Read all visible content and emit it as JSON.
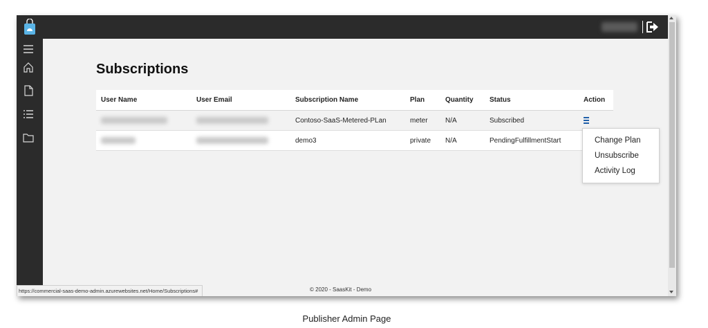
{
  "page": {
    "title": "Subscriptions"
  },
  "table": {
    "headers": [
      "User Name",
      "User Email",
      "Subscription Name",
      "Plan",
      "Quantity",
      "Status",
      "Action"
    ],
    "rows": [
      {
        "subscription_name": "Contoso-SaaS-Metered-PLan",
        "plan": "meter",
        "quantity": "N/A",
        "status": "Subscribed"
      },
      {
        "subscription_name": "demo3",
        "plan": "private",
        "quantity": "N/A",
        "status": "PendingFulfillmentStart"
      }
    ]
  },
  "action_menu": {
    "items": [
      "Change Plan",
      "Unsubscribe",
      "Activity Log"
    ]
  },
  "statusbar": {
    "url": "https://commercial-saas-demo-admin.azurewebsites.net/Home/Subscriptions#"
  },
  "footer": {
    "copyright": "© 2020 - SaasKit - Demo"
  },
  "caption": "Publisher Admin Page",
  "icons": {
    "logo": "shopping-bag-icon",
    "logout": "logout-icon",
    "sidebar": [
      "hamburger-icon",
      "home-icon",
      "document-icon",
      "list-icon",
      "folder-icon"
    ],
    "action": "menu-icon"
  },
  "colors": {
    "topbar": "#2b2b2b",
    "content_bg": "#f2f2f2",
    "logo_accent": "#5ab4e6",
    "action_icon": "#1f5fa8"
  }
}
